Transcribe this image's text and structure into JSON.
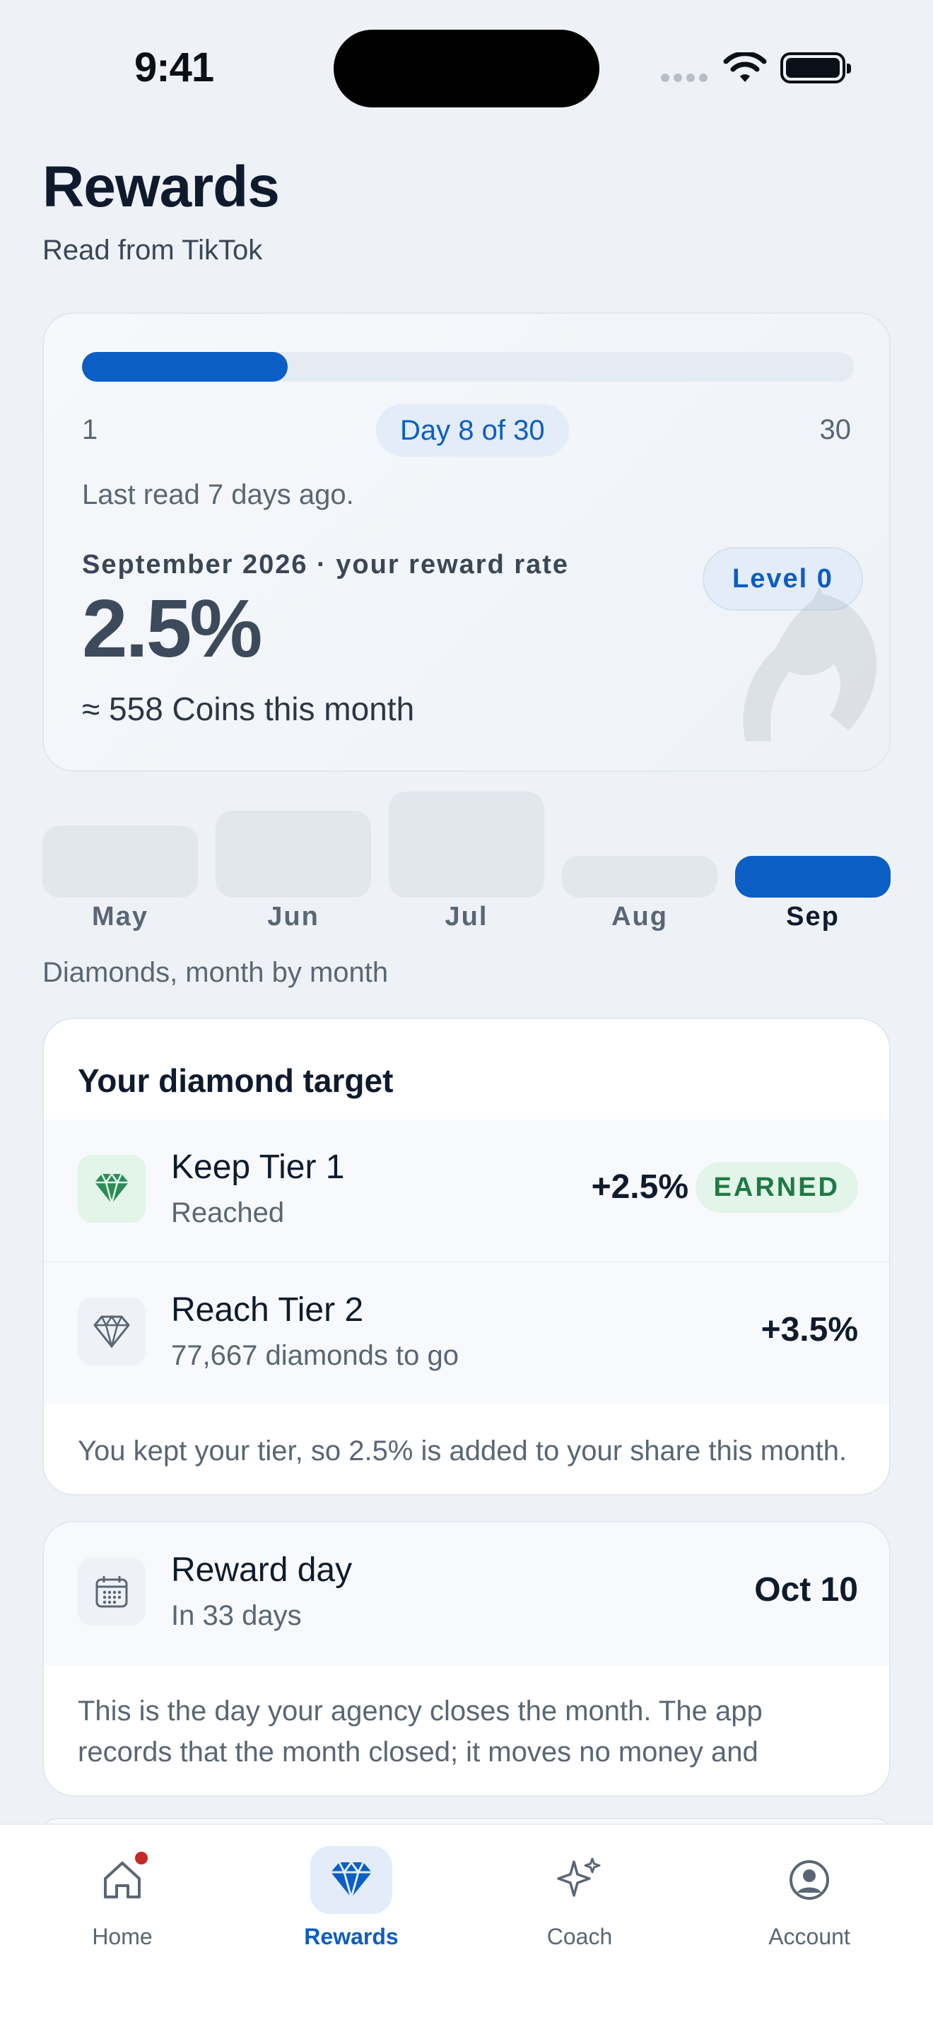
{
  "status_bar": {
    "time": "9:41"
  },
  "header": {
    "title": "Rewards",
    "subtitle": "Read from TikTok"
  },
  "progress": {
    "range_start": "1",
    "range_end": "30",
    "current_day": 8,
    "total_days": 30,
    "day_label": "Day 8 of 30",
    "last_read": "Last read 7 days ago.",
    "rate_caption": "September 2026 · your reward rate",
    "rate_value": "2.5%",
    "level_label": "Level 0",
    "coins_text": "≈ 558 Coins this month"
  },
  "months": [
    {
      "label": "May",
      "level": 0.38,
      "active": false
    },
    {
      "label": "Jun",
      "level": 0.46,
      "active": false
    },
    {
      "label": "Jul",
      "level": 0.56,
      "active": false
    },
    {
      "label": "Aug",
      "level": 0.22,
      "active": false
    },
    {
      "label": "Sep",
      "level": 0.22,
      "active": true
    }
  ],
  "months_caption": "Diamonds, month by month",
  "target": {
    "title": "Your diamond target",
    "rows": [
      {
        "title": "Keep Tier 1",
        "subtitle": "Reached",
        "value": "+2.5%",
        "badge": "EARNED",
        "icon": "diamond-icon"
      },
      {
        "title": "Reach Tier 2",
        "subtitle": "77,667 diamonds to go",
        "value": "+3.5%",
        "icon": "diamond-outline-icon"
      }
    ],
    "note": "You kept your tier, so 2.5% is added to your share this month."
  },
  "reward_day": {
    "title": "Reward day",
    "subtitle": "In 33 days",
    "date": "Oct 10",
    "icon": "calendar-icon",
    "note": "This is the day your agency closes the month. The app records that the month closed; it moves no money and make…"
  },
  "nav": [
    {
      "label": "Home",
      "icon": "home-icon",
      "active": false,
      "dot": true
    },
    {
      "label": "Rewards",
      "icon": "diamond-icon",
      "active": true
    },
    {
      "label": "Coach",
      "icon": "sparkles-icon",
      "active": false
    },
    {
      "label": "Account",
      "icon": "account-icon",
      "active": false
    }
  ],
  "colors": {
    "accent": "#0b5ec3",
    "earned_green": "#1f7a45",
    "notify_red": "#c62828"
  }
}
